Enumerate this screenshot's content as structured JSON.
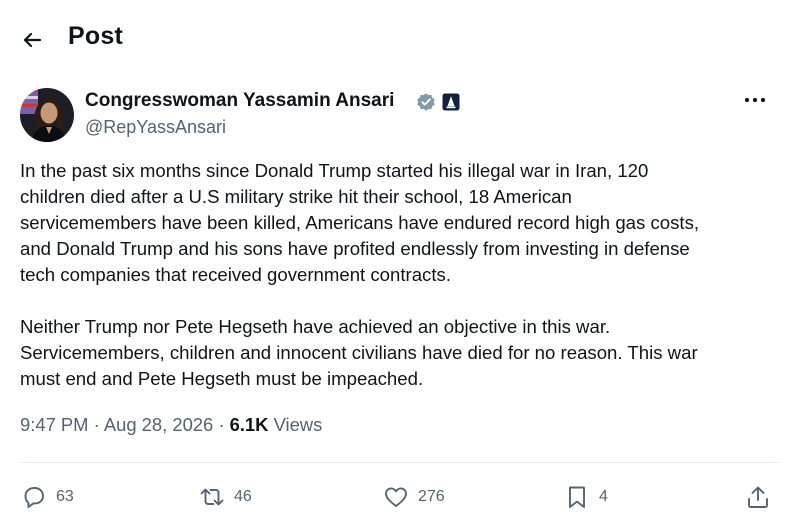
{
  "header": {
    "title": "Post"
  },
  "author": {
    "name": "Congresswoman Yassamin Ansari",
    "handle": "@RepYassAnsari"
  },
  "post": {
    "paragraph1_lines": [
      "In the past six months since Donald Trump started his illegal war in Iran, 120",
      "children died after a U.S military strike hit their school, 18 American",
      "servicemembers have been killed, Americans have endured record high gas costs,",
      "and Donald Trump and his sons have profited endlessly from investing in defense",
      "tech companies that received government contracts."
    ],
    "paragraph2_lines": [
      "Neither Trump nor Pete Hegseth have achieved an objective in this war.",
      "Servicemembers, children and innocent civilians have died for no reason. This war",
      "must end and Pete Hegseth must be impeached."
    ]
  },
  "meta": {
    "time": "9:47 PM",
    "separator": " · ",
    "date": "Aug 28, 2026",
    "views_count": "6.1K",
    "views_label": " Views"
  },
  "actions": {
    "replies": "63",
    "reposts": "46",
    "likes": "276",
    "bookmarks": "4"
  },
  "icons": {
    "back": "arrow-left-icon",
    "verified": "verified-badge-icon",
    "affiliation": "government-affiliation-icon",
    "more": "more-horizontal-icon",
    "reply": "reply-icon",
    "repost": "repost-icon",
    "like": "heart-icon",
    "bookmark": "bookmark-icon",
    "share": "share-icon"
  },
  "colors": {
    "text_primary": "#0f1419",
    "text_secondary": "#536471",
    "verified_badge": "#829aab",
    "divider": "#e6ecf0"
  }
}
